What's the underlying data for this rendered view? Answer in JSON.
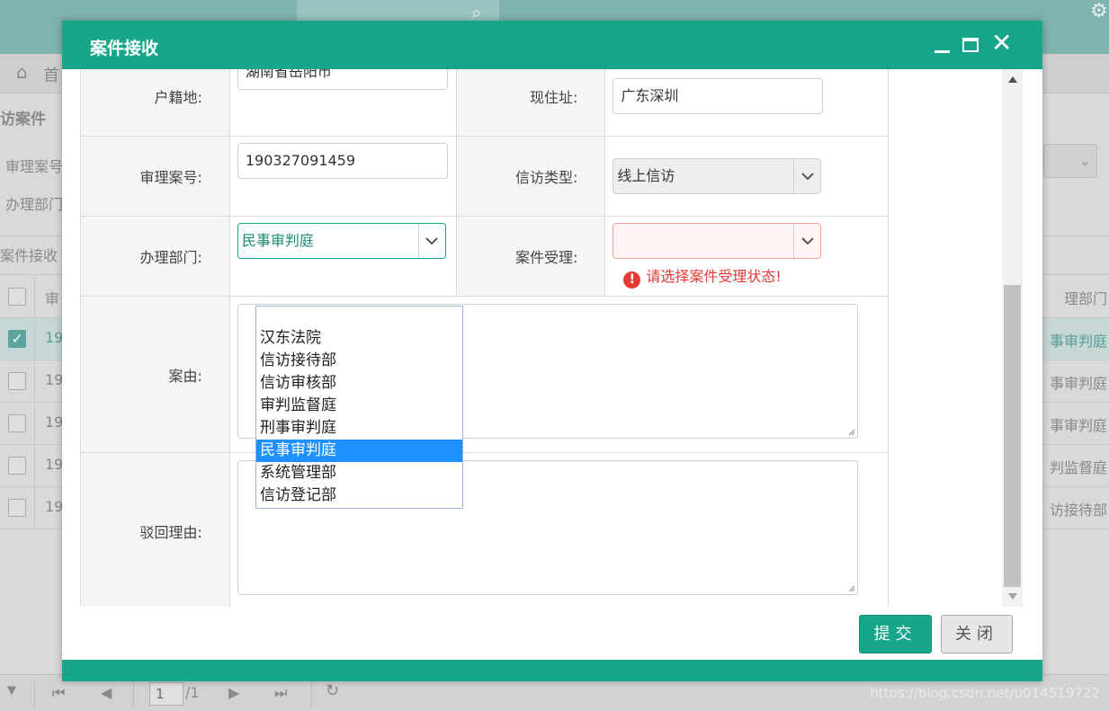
{
  "background": {
    "home_label": "首",
    "panel_title": "访案件",
    "filter_case_no": "审理案号",
    "filter_dept": "办理部门",
    "toolbar_label": "案件接收",
    "grid_header_left": "审",
    "grid_header_right": "理部门",
    "rows": [
      {
        "left": "19",
        "right": "事审判庭"
      },
      {
        "left": "19",
        "right": "事审判庭"
      },
      {
        "left": "19",
        "right": "事审判庭"
      },
      {
        "left": "19",
        "right": "判监督庭"
      },
      {
        "left": "19",
        "right": "访接待部"
      }
    ],
    "pager": {
      "dropdown": "▼",
      "page": "1",
      "total": "/1"
    },
    "watermark": "https://blog.csdn.net/u014519722"
  },
  "dialog": {
    "title": "案件接收",
    "form": {
      "residence_label": "户籍地:",
      "residence_value": "湖南省岳阳市",
      "address_label": "现住址:",
      "address_value": "广东深圳",
      "case_no_label": "审理案号:",
      "case_no_value": "190327091459",
      "petition_type_label": "信访类型:",
      "petition_type_value": "线上信访",
      "dept_label": "办理部门:",
      "dept_value": "民事审判庭",
      "acceptance_label": "案件受理:",
      "acceptance_value": "",
      "acceptance_error": "请选择案件受理状态!",
      "reason_label": "案由:",
      "reject_label": "驳回理由:"
    },
    "dept_options": [
      "",
      "汉东法院",
      "信访接待部",
      "信访审核部",
      "审判监督庭",
      "刑事审判庭",
      "民事审判庭",
      "系统管理部",
      "信访登记部"
    ],
    "selected_option": "民事审判庭",
    "buttons": {
      "submit": "提交",
      "close": "关闭"
    }
  },
  "colors": {
    "accent": "#17a689",
    "error": "#e53935",
    "selected": "#1e90ff"
  }
}
